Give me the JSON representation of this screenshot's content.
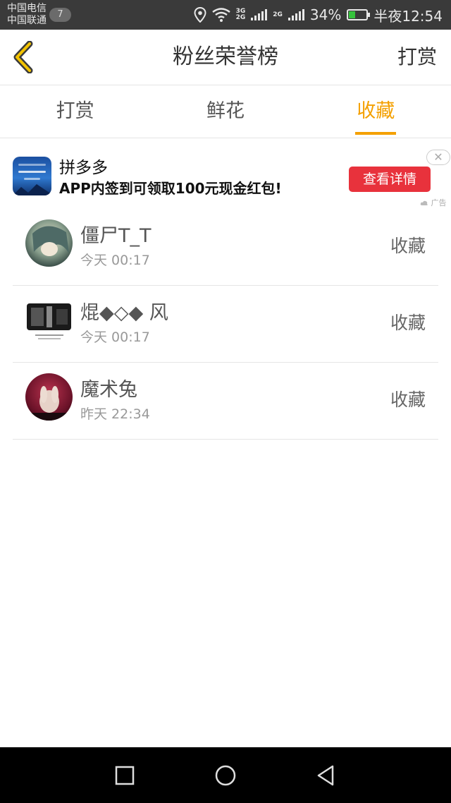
{
  "status_bar": {
    "carrier_1": "中国电信",
    "carrier_2": "中国联通",
    "notification_count": "7",
    "network_3g_label": "3G",
    "network_2g_label": "2G",
    "network_2g_label_b": "2G",
    "battery_percent": "34%",
    "battery_level": 0.34,
    "time": "半夜12:54"
  },
  "header": {
    "title": "粉丝荣誉榜",
    "action_label": "打赏",
    "back_icon": "chevron-left-icon"
  },
  "tabs": [
    {
      "label": "打赏",
      "active": false
    },
    {
      "label": "鲜花",
      "active": false
    },
    {
      "label": "收藏",
      "active": true
    }
  ],
  "ad": {
    "app_name": "拼多多",
    "description": "APP内签到可领取100元现金红包!",
    "button_label": "查看详情",
    "close_symbol": "✕",
    "tag": "广告"
  },
  "list": [
    {
      "name": "僵尸T_T",
      "time": "今天 00:17",
      "action": "收藏"
    },
    {
      "name": "焜◆◇◆ 风",
      "time": "今天 00:17",
      "action": "收藏"
    },
    {
      "name": "魔术兔",
      "time": "昨天 22:34",
      "action": "收藏"
    }
  ],
  "colors": {
    "accent": "#f4a000",
    "ad_button": "#e8323c",
    "status_bar_bg": "#3a3a3a"
  }
}
